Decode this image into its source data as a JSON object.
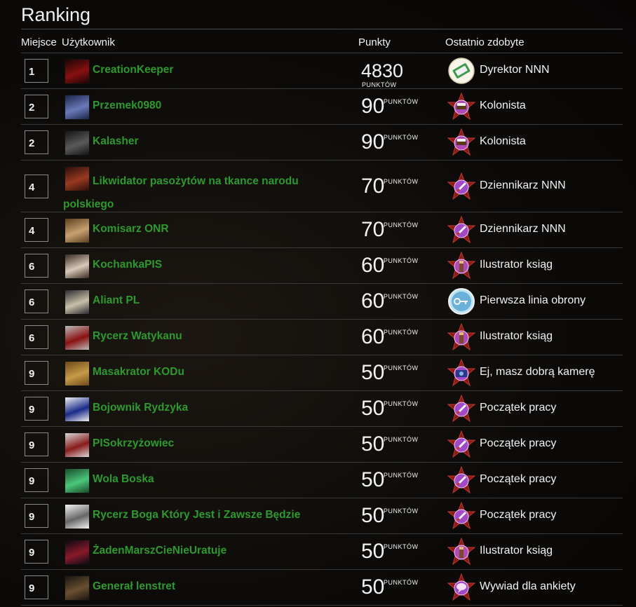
{
  "page": {
    "title": "Ranking"
  },
  "columns": {
    "place": "Miejsce",
    "user": "Użytkownik",
    "points": "Punkty",
    "last": "Ostatnio zdobyte"
  },
  "points_unit": "PUNKTÓW",
  "colors": {
    "username": "#2e9a2e",
    "background": "#0d0b09",
    "rule": "#3a3a3a"
  },
  "rows": [
    {
      "place": "1",
      "user": "CreationKeeper",
      "points": "4830",
      "badge": "Dyrektor NNN",
      "badge_icon": "certificate-badge-icon",
      "avatar": "dark-red-sword-avatar"
    },
    {
      "place": "2",
      "user": "Przemek0980",
      "points": "90",
      "badge": "Kolonista",
      "badge_icon": "wagon-star-icon",
      "avatar": "blue-armor-avatar"
    },
    {
      "place": "2",
      "user": "Kalasher",
      "points": "90",
      "badge": "Kolonista",
      "badge_icon": "wagon-star-icon",
      "avatar": "dark-warrior-avatar"
    },
    {
      "place": "4",
      "user": "Likwidator pasożytów na tkance narodu polskiego",
      "points": "70",
      "badge": "Dziennikarz NNN",
      "badge_icon": "pen-star-icon",
      "avatar": "red-knight-avatar"
    },
    {
      "place": "4",
      "user": "Komisarz ONR",
      "points": "70",
      "badge": "Dziennikarz NNN",
      "badge_icon": "pen-star-icon",
      "avatar": "golden-face-avatar"
    },
    {
      "place": "6",
      "user": "KochankaPIS",
      "points": "60",
      "badge": "Ilustrator ksiąg",
      "badge_icon": "brush-star-icon",
      "avatar": "crusader-avatar"
    },
    {
      "place": "6",
      "user": "Aliant PL",
      "points": "60",
      "badge": "Pierwsza linia obrony",
      "badge_icon": "key-circle-icon",
      "avatar": "stone-knight-avatar"
    },
    {
      "place": "6",
      "user": "Rycerz Watykanu",
      "points": "60",
      "badge": "Ilustrator ksiąg",
      "badge_icon": "brush-star-icon",
      "avatar": "templar-avatar"
    },
    {
      "place": "9",
      "user": "Masakrator KODu",
      "points": "50",
      "badge": "Ej, masz dobrą kamerę",
      "badge_icon": "camera-star-icon",
      "avatar": "sepia-figure-avatar"
    },
    {
      "place": "9",
      "user": "Bojownik Rydzyka",
      "points": "50",
      "badge": "Początek pracy",
      "badge_icon": "pen-star-icon",
      "avatar": "blue-hood-avatar"
    },
    {
      "place": "9",
      "user": "PISokrzyżowiec",
      "points": "50",
      "badge": "Początek pracy",
      "badge_icon": "pen-star-icon",
      "avatar": "white-crusader-avatar"
    },
    {
      "place": "9",
      "user": "Wola Boska",
      "points": "50",
      "badge": "Początek pracy",
      "badge_icon": "pen-star-icon",
      "avatar": "green-ghost-avatar"
    },
    {
      "place": "9",
      "user": "Rycerz Boga Który Jest i Zawsze Będzie",
      "points": "50",
      "badge": "Początek pracy",
      "badge_icon": "pen-star-icon",
      "avatar": "sketch-knight-avatar"
    },
    {
      "place": "9",
      "user": "ŻadenMarszCieNieUratuje",
      "points": "50",
      "badge": "Ilustrator ksiąg",
      "badge_icon": "brush-star-icon",
      "avatar": "dark-mask-avatar"
    },
    {
      "place": "9",
      "user": "Generał lenstret",
      "points": "50",
      "badge": "Wywiad dla ankiety",
      "badge_icon": "speech-star-icon",
      "avatar": "hooded-rider-avatar"
    }
  ]
}
